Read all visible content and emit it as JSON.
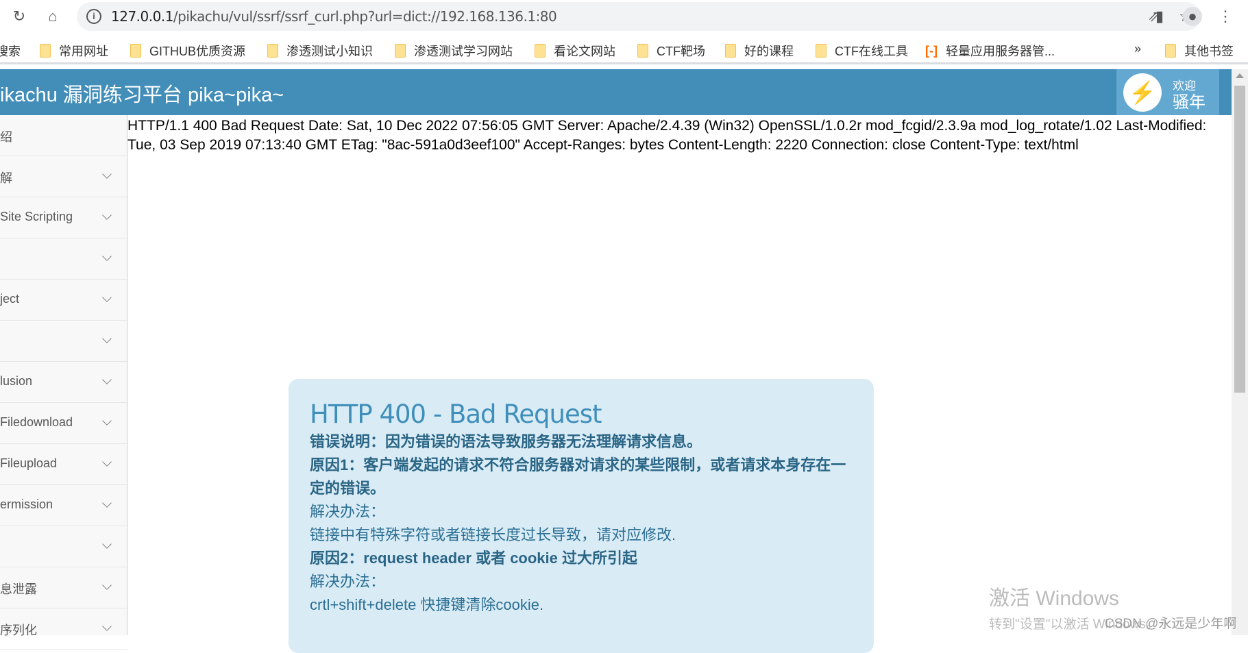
{
  "browser": {
    "url_host": "127.0.0.1",
    "url_path": "/pikachu/vul/ssrf/ssrf_curl.php?url=dict://192.168.136.1:80",
    "bookmarks": [
      "搜索",
      "常用网址",
      "GITHUB优质资源",
      "渗透测试小知识",
      "渗透测试学习网站",
      "看论文网站",
      "CTF靶场",
      "好的课程",
      "CTF在线工具",
      "轻量应用服务器管..."
    ],
    "overflow": "»",
    "other_bookmarks": "其他书签"
  },
  "header": {
    "title": "ikachu 漏洞练习平台 pika~pika~",
    "welcome_1": "欢迎",
    "welcome_2": "骚年"
  },
  "sidebar": {
    "items": [
      {
        "label": "绍",
        "expandable": false
      },
      {
        "label": "解",
        "expandable": true
      },
      {
        "label": "Site Scripting",
        "expandable": true
      },
      {
        "label": "",
        "expandable": true
      },
      {
        "label": "ject",
        "expandable": true
      },
      {
        "label": "",
        "expandable": true
      },
      {
        "label": "lusion",
        "expandable": true
      },
      {
        "label": " Filedownload",
        "expandable": true
      },
      {
        "label": " Fileupload",
        "expandable": true
      },
      {
        "label": "ermission",
        "expandable": true
      },
      {
        "label": "",
        "expandable": true
      },
      {
        "label": "息泄露",
        "expandable": true
      },
      {
        "label": "序列化",
        "expandable": true
      }
    ]
  },
  "response": {
    "raw": "HTTP/1.1 400 Bad Request Date: Sat, 10 Dec 2022 07:56:05 GMT Server: Apache/2.4.39 (Win32) OpenSSL/1.0.2r mod_fcgid/2.3.9a mod_log_rotate/1.02 Last-Modified: Tue, 03 Sep 2019 07:13:40 GMT ETag: \"8ac-591a0d3eef100\" Accept-Ranges: bytes Content-Length: 2220 Connection: close Content-Type: text/html"
  },
  "error": {
    "title": "HTTP 400 - Bad Request",
    "desc": "错误说明：因为错误的语法导致服务器无法理解请求信息。",
    "reason1": "原因1：客户端发起的请求不符合服务器对请求的某些限制，或者请求本身存在一定的错误。",
    "fix_label1": "解决办法：",
    "fix1": "链接中有特殊字符或者链接长度过长导致，请对应修改.",
    "reason2": "原因2：request header 或者 cookie 过大所引起",
    "fix_label2": "解决办法：",
    "fix2": "crtl+shift+delete 快捷键清除cookie."
  },
  "watermark": {
    "line1": "激活 Windows",
    "line2": "转到\"设置\"以激活 Windows。"
  },
  "csdn": "CSDN @永远是少年啊"
}
